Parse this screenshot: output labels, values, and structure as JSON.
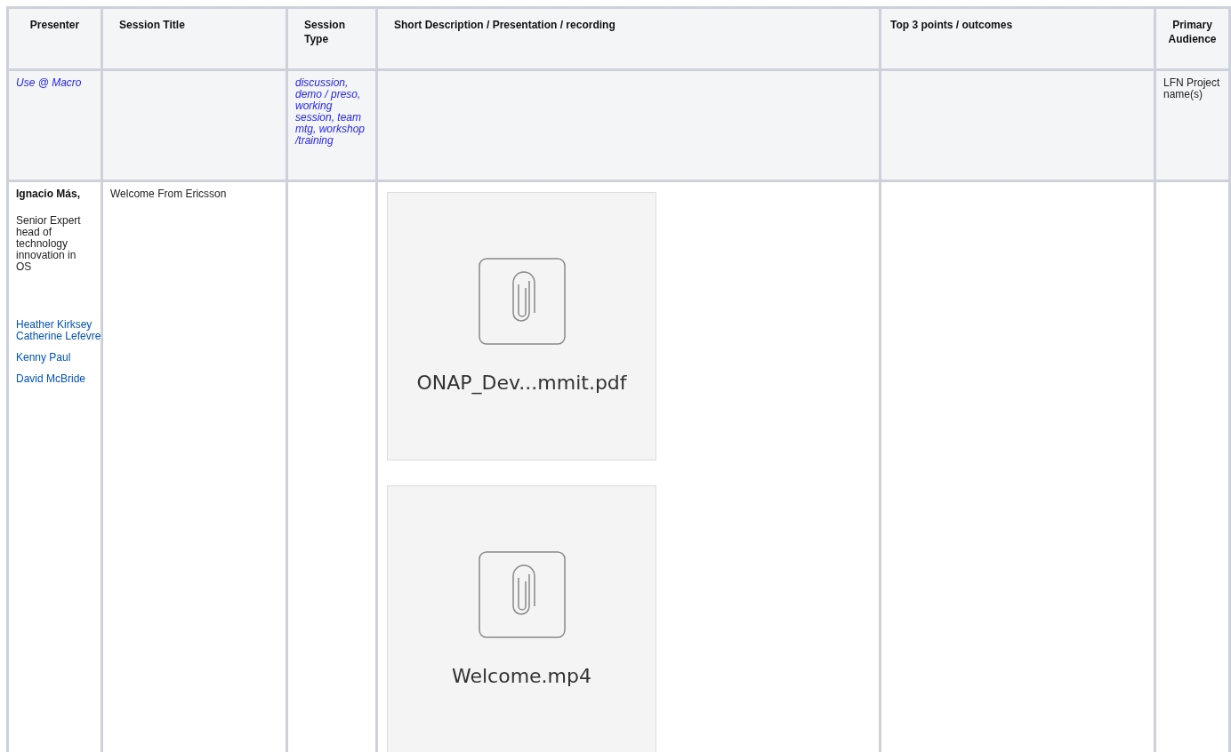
{
  "table": {
    "columns": [
      {
        "label": "Presenter"
      },
      {
        "label": "Session Title"
      },
      {
        "label": "Session Type"
      },
      {
        "label": "Short Description / Presentation  / recording"
      },
      {
        "label": "Top 3 points / outcomes"
      },
      {
        "label": "Primary Audience"
      }
    ],
    "template_row": [
      {
        "text": "Use @ Macro",
        "kind": "hint"
      },
      {
        "kind": "empty"
      },
      {
        "text": "discussion, demo / preso, working session, team mtg, workshop /training",
        "kind": "hint"
      },
      {
        "kind": "empty"
      },
      {
        "kind": "empty"
      },
      {
        "text": "LFN Project name(s)",
        "kind": "plain"
      }
    ],
    "rows": [
      {
        "presenter": {
          "name": "Ignacio Más,",
          "role_lines": [
            "Senior Expert",
            "head of technology innovation in OS"
          ],
          "mention_groups": [
            [
              "Heather Kirksey",
              "Catherine Lefevre"
            ],
            [
              "Kenny Paul"
            ],
            [
              "David McBride"
            ]
          ]
        },
        "session_title": "Welcome From Ericsson",
        "attachments": [
          {
            "file_name": "ONAP_Dev...mmit.pdf"
          },
          {
            "file_name": "Welcome.mp4"
          }
        ]
      }
    ]
  }
}
